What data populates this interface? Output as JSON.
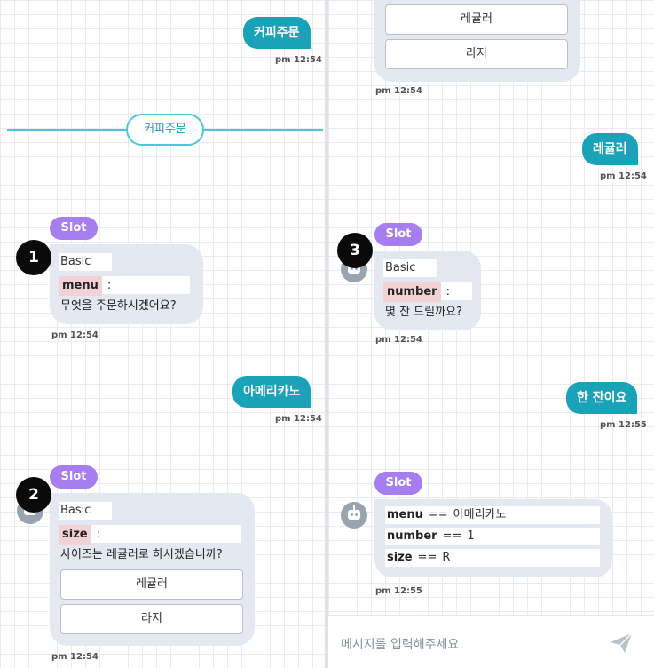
{
  "colors": {
    "accent": "#1aa3b8",
    "slot_badge": "#a77ef0",
    "bot_card": "#e4e9f1",
    "slot_highlight": "#f3d2d6",
    "separator": "#4cc6d8"
  },
  "left": {
    "user_msg_1": {
      "text": "커피주문",
      "time": "pm 12:54"
    },
    "separator_label": "커피주문",
    "slot_card_1": {
      "marker": "1",
      "badge": "Slot",
      "title": "Basic",
      "slot_name": "menu",
      "colon": ":",
      "prompt": "무엇을 주문하시겠어요?",
      "time": "pm 12:54"
    },
    "user_msg_2": {
      "text": "아메리카노",
      "time": "pm 12:54"
    },
    "slot_card_2": {
      "marker": "2",
      "badge": "Slot",
      "title": "Basic",
      "slot_name": "size",
      "colon": ":",
      "prompt": "사이즈는 레귤러로 하시겠습니까?",
      "options": [
        "레귤러",
        "라지"
      ],
      "time": "pm 12:54"
    }
  },
  "right": {
    "top_card": {
      "options": [
        "레귤러",
        "라지"
      ],
      "time": "pm 12:54"
    },
    "user_msg_1": {
      "text": "레귤러",
      "time": "pm 12:54"
    },
    "slot_card_3": {
      "marker": "3",
      "badge": "Slot",
      "title": "Basic",
      "slot_name": "number",
      "colon": ":",
      "prompt": "몇 잔 드릴까요?",
      "time": "pm 12:54"
    },
    "user_msg_2": {
      "text": "한 잔이요",
      "time": "pm 12:55"
    },
    "result_card": {
      "badge": "Slot",
      "rows": [
        {
          "key": "menu",
          "op": "==",
          "value": "아메리카노"
        },
        {
          "key": "number",
          "op": "==",
          "value": "1"
        },
        {
          "key": "size",
          "op": "==",
          "value": "R"
        }
      ],
      "time": "pm 12:55"
    },
    "input": {
      "placeholder": "메시지를 입력해주세요",
      "send_icon": "send-icon"
    }
  }
}
